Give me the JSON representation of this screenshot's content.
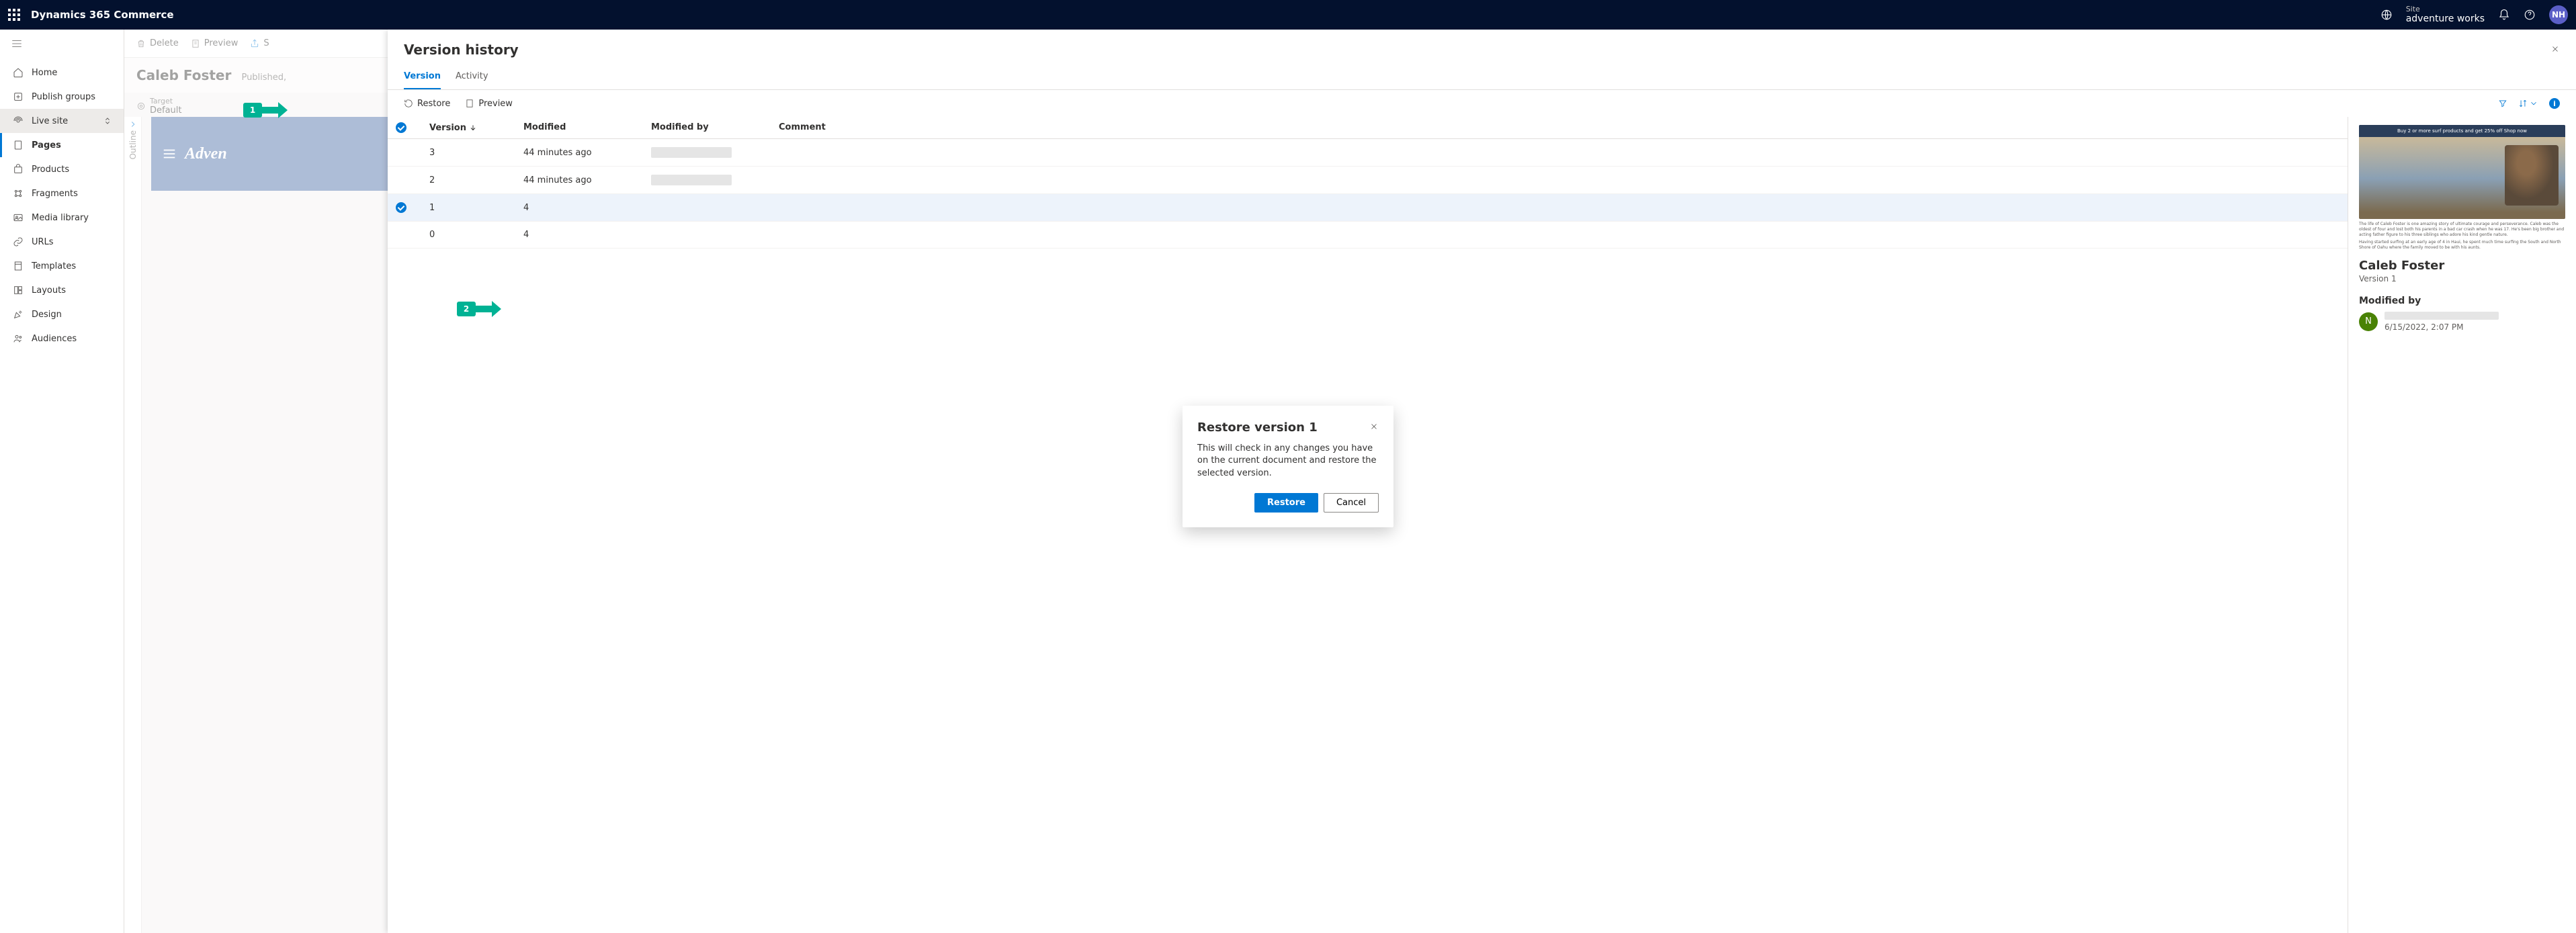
{
  "topbar": {
    "product": "Dynamics 365 Commerce",
    "site_label": "Site",
    "site_name": "adventure works",
    "avatar_initials": "NH"
  },
  "leftnav": {
    "items": [
      {
        "label": "Home",
        "icon": "home"
      },
      {
        "label": "Publish groups",
        "icon": "publish"
      },
      {
        "label": "Live site",
        "icon": "live",
        "livesite": true
      },
      {
        "label": "Pages",
        "icon": "pages",
        "active": true
      },
      {
        "label": "Products",
        "icon": "products"
      },
      {
        "label": "Fragments",
        "icon": "fragments"
      },
      {
        "label": "Media library",
        "icon": "media"
      },
      {
        "label": "URLs",
        "icon": "urls"
      },
      {
        "label": "Templates",
        "icon": "templates"
      },
      {
        "label": "Layouts",
        "icon": "layouts"
      },
      {
        "label": "Design",
        "icon": "design"
      },
      {
        "label": "Audiences",
        "icon": "audiences"
      }
    ]
  },
  "commandbar": {
    "delete": "Delete",
    "preview": "Preview",
    "more": "S"
  },
  "page": {
    "title": "Caleb Foster",
    "status": "Published,",
    "target_label": "Target",
    "target_value": "Default",
    "outline": "Outline",
    "canvas_brand": "Adven"
  },
  "panel": {
    "title": "Version history",
    "tabs": {
      "version": "Version",
      "activity": "Activity"
    },
    "toolbar": {
      "restore": "Restore",
      "preview": "Preview"
    },
    "columns": {
      "version": "Version",
      "modified": "Modified",
      "modified_by": "Modified by",
      "comment": "Comment"
    },
    "rows": [
      {
        "version": "3",
        "modified": "44 minutes ago",
        "selected": false
      },
      {
        "version": "2",
        "modified": "44 minutes ago",
        "selected": false
      },
      {
        "version": "1",
        "modified": "4",
        "selected": true
      },
      {
        "version": "0",
        "modified": "4",
        "selected": false
      }
    ],
    "detail": {
      "thumb_banner": "Buy 2 or more surf products and get 25% off   Shop now",
      "caption1": "The life of Caleb Foster is one amazing story of ultimate courage and perseverance. Caleb was the oldest of four and lost both his parents in a bad car crash when he was 17. He's been big brother and acting father figure to his three siblings who adore his kind gentle nature.",
      "caption2": "Having started surfing at an early age of 4 in Haui, he spent much time surfing the South and North Shore of Oahu where the family moved to be with his aunts.",
      "title": "Caleb Foster",
      "version": "Version 1",
      "modified_by_label": "Modified by",
      "avatar_initial": "N",
      "timestamp": "6/15/2022, 2:07 PM"
    }
  },
  "modal": {
    "title": "Restore version 1",
    "body": "This will check in any changes you have on the current document and restore the selected version.",
    "restore": "Restore",
    "cancel": "Cancel"
  },
  "callouts": {
    "one": "1",
    "two": "2"
  }
}
